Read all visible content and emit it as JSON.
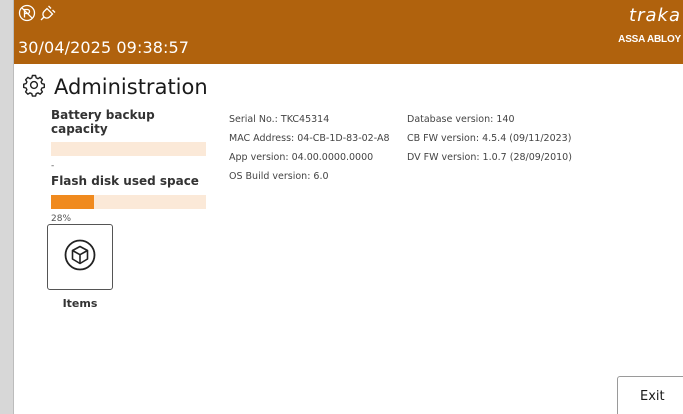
{
  "header": {
    "datetime": "30/04/2025 09:38:57",
    "brand_name": "traka",
    "brand_sub": "ASSA ABLOY",
    "status_icons": [
      "no-network-icon",
      "power-plug-icon"
    ],
    "background_color": "#b0620d"
  },
  "page": {
    "title": "Administration",
    "title_icon": "gear-icon"
  },
  "battery": {
    "label": "Battery backup capacity",
    "value": "-",
    "level_fraction": 0
  },
  "flash": {
    "label": "Flash disk used space",
    "value": "28%",
    "level_fraction": 0.28,
    "fill_color": "#f08a1e",
    "track_color": "#fbe9d8"
  },
  "info_left": {
    "serial": "Serial No.: TKC45314",
    "mac": "MAC Address: 04-CB-1D-83-02-A8",
    "app_version": "App version: 04.00.0000.0000",
    "os_build": "OS Build version: 6.0"
  },
  "info_right": {
    "database_version": "Database version: 140",
    "cb_fw": "CB FW version: 4.5.4 (09/11/2023)",
    "dv_fw": "DV FW version: 1.0.7 (28/09/2010)"
  },
  "tiles": [
    {
      "label": "Items",
      "icon": "cube-icon"
    }
  ],
  "footer": {
    "exit_label": "Exit"
  }
}
